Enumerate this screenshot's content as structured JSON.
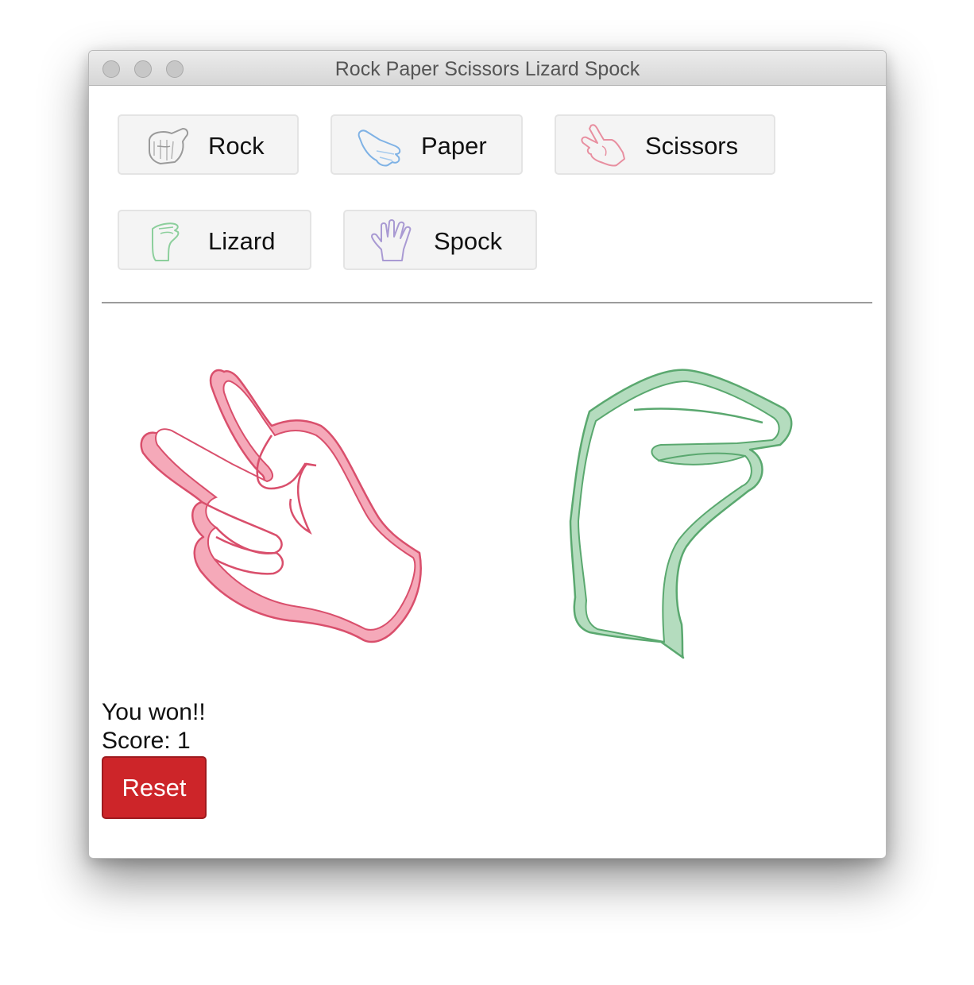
{
  "window": {
    "title": "Rock Paper Scissors Lizard Spock"
  },
  "choices": [
    {
      "label": "Rock",
      "icon": "rock-hand-icon",
      "color": "#9a9a9a"
    },
    {
      "label": "Paper",
      "icon": "paper-hand-icon",
      "color": "#7fb2e5"
    },
    {
      "label": "Scissors",
      "icon": "scissors-hand-icon",
      "color": "#e88fa0"
    },
    {
      "label": "Lizard",
      "icon": "lizard-hand-icon",
      "color": "#8ccf9c"
    },
    {
      "label": "Spock",
      "icon": "spock-hand-icon",
      "color": "#a99ad3"
    }
  ],
  "arena": {
    "player_hand": {
      "icon": "scissors-hand-icon",
      "stroke": "#d94f6c",
      "fill": "#f5a9b9"
    },
    "computer_hand": {
      "icon": "lizard-hand-icon",
      "stroke": "#5aa86f",
      "fill": "#b4dcbe"
    }
  },
  "result": {
    "message": "You won!!",
    "score_text": "Score: 1"
  },
  "reset": {
    "label": "Reset",
    "color": "#cd2529"
  }
}
